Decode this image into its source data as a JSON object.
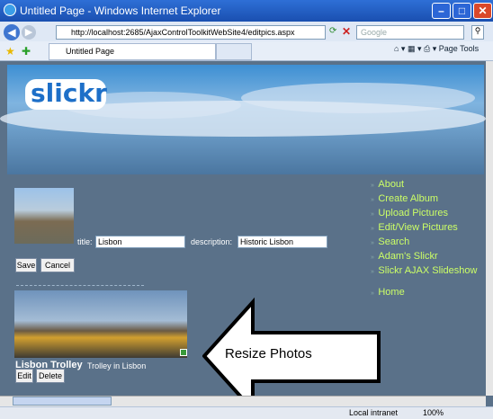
{
  "window": {
    "title": "Untitled Page - Windows Internet Explorer",
    "url": "http://localhost:2685/AjaxControlToolkitWebSite4/editpics.aspx",
    "search_placeholder": "Google",
    "tab_label": "Untitled Page",
    "toolbar_page": "Page",
    "toolbar_tools": "Tools"
  },
  "site": {
    "logo": "slickr"
  },
  "nav": [
    {
      "label": "About"
    },
    {
      "label": "Create Album"
    },
    {
      "label": "Upload Pictures"
    },
    {
      "label": "Edit/View Pictures"
    },
    {
      "label": "Search"
    },
    {
      "label": "Adam's Slickr"
    },
    {
      "label": "Slickr AJAX Slideshow"
    }
  ],
  "nav_home": "Home",
  "edit_form": {
    "title_label": "title:",
    "title_value": "Lisbon",
    "description_label": "description:",
    "description_value": "Historic Lisbon",
    "save_label": "Save",
    "cancel_label": "Cancel"
  },
  "photo": {
    "title": "Lisbon Trolley",
    "description": "Trolley in Lisbon",
    "edit_label": "Edit",
    "delete_label": "Delete"
  },
  "callout": "Resize Photos",
  "status": {
    "zone": "Local intranet",
    "zoom": "100%"
  }
}
